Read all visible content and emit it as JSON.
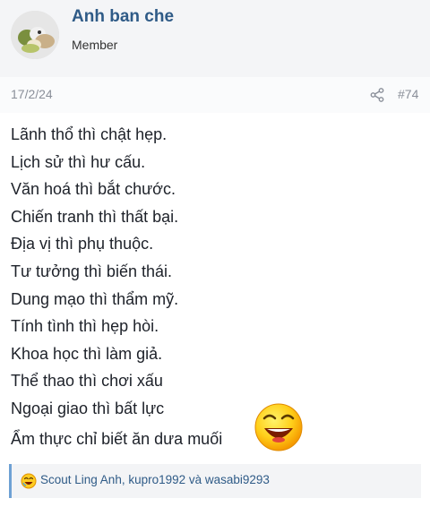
{
  "author": {
    "name": "Anh ban che",
    "title": "Member"
  },
  "post": {
    "date": "17/2/24",
    "number": "#74",
    "lines": [
      "Lãnh thổ thì chật hẹp.",
      "Lịch sử thì hư cấu.",
      "Văn hoá thì bắt chước.",
      "Chiến tranh thì thất bại.",
      "Địa vị thì phụ thuộc.",
      "Tư tưởng thì biến thái.",
      "Dung mạo thì thẩm mỹ.",
      "Tính tình thì hẹp hòi.",
      "Khoa học thì làm giả.",
      "Thể thao thì chơi xấu",
      "Ngoại giao thì bất lực"
    ],
    "last_line": "Ẩm thực chỉ biết ăn dưa muối"
  },
  "reactions": {
    "text": "Scout Ling Anh, kupro1992 và wasabi9293"
  },
  "icons": {
    "share": "share-icon",
    "laugh": "laughing-emoji-icon",
    "reaction": "haha-reaction-icon"
  },
  "colors": {
    "link": "#2f5b87",
    "accent_bar": "#6ea1d4",
    "meta": "#8a8f99"
  }
}
